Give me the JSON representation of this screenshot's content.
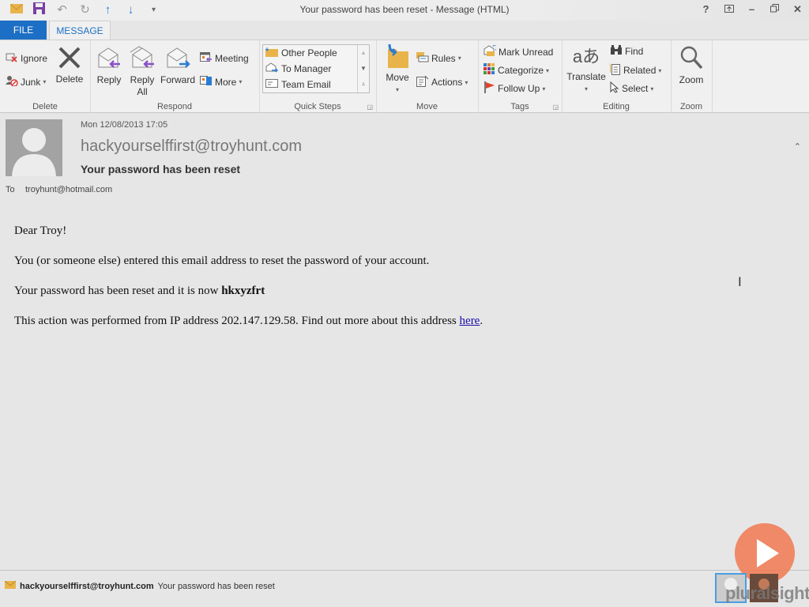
{
  "window": {
    "title": "Your password has been reset - Message (HTML)",
    "quick_access": [
      "mail-icon",
      "save-icon",
      "undo-icon",
      "redo-icon",
      "previous-item-icon",
      "next-item-icon",
      "customize-qat-icon"
    ],
    "controls": {
      "help": "?",
      "ribbon_display": "ribbon-display-options",
      "minimize": "–",
      "restore": "restore",
      "close": "✕"
    }
  },
  "tabs": {
    "file": "FILE",
    "message": "MESSAGE"
  },
  "ribbon": {
    "delete": {
      "label": "Delete",
      "ignore": "Ignore",
      "junk": "Junk",
      "delete": "Delete"
    },
    "respond": {
      "label": "Respond",
      "reply": "Reply",
      "reply_all_1": "Reply",
      "reply_all_2": "All",
      "forward": "Forward",
      "meeting": "Meeting",
      "more": "More"
    },
    "quick_steps": {
      "label": "Quick Steps",
      "items": [
        "Other People",
        "To Manager",
        "Team Email"
      ]
    },
    "move": {
      "label": "Move",
      "move": "Move",
      "rules": "Rules",
      "actions": "Actions"
    },
    "tags": {
      "label": "Tags",
      "mark_unread": "Mark Unread",
      "categorize": "Categorize",
      "follow_up": "Follow Up"
    },
    "editing": {
      "label": "Editing",
      "translate": "Translate",
      "find": "Find",
      "related": "Related",
      "select": "Select"
    },
    "zoom": {
      "label": "Zoom",
      "zoom": "Zoom"
    }
  },
  "message": {
    "date": "Mon 12/08/2013 17:05",
    "from": "hackyourselffirst@troyhunt.com",
    "subject": "Your password has been reset",
    "to_label": "To",
    "to": "troyhunt@hotmail.com",
    "body": {
      "greeting": "Dear Troy!",
      "line1": "You (or someone else) entered this email address to reset the password of your account.",
      "line2_prefix": "Your password has been reset and it is now ",
      "password": "hkxyzfrt",
      "line3_prefix": "This action was performed from IP address 202.147.129.58. Find out more about this address ",
      "link": "here",
      "line3_suffix": "."
    }
  },
  "statusbar": {
    "sender": "hackyourselffirst@troyhunt.com",
    "subject": "Your password has been reset"
  },
  "watermark": {
    "brand": "pluralsight"
  },
  "colors": {
    "accent": "#1c6fc4",
    "reply_arrow": "#8b4fc9",
    "forward_arrow": "#2a7bd4",
    "folder": "#e8b44a"
  }
}
